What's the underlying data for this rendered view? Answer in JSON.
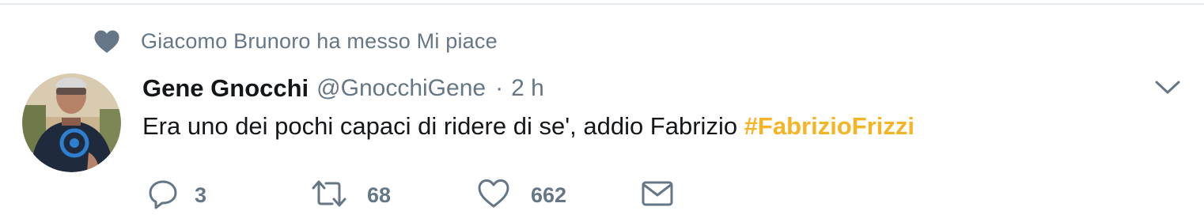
{
  "context": {
    "icon": "heart-icon",
    "text": "Giacomo Brunoro ha messo Mi piace"
  },
  "tweet": {
    "avatar": "avatar",
    "display_name": "Gene Gnocchi",
    "handle": "@GnocchiGene",
    "separator": "·",
    "time": "2 h",
    "text": "Era uno dei pochi capaci di ridere di se', addio Fabrizio ",
    "hashtag": "#FabrizioFrizzi",
    "menu_icon": "chevron-down-icon"
  },
  "actions": {
    "reply": {
      "icon": "reply-icon",
      "count": "3"
    },
    "retweet": {
      "icon": "retweet-icon",
      "count": "68"
    },
    "like": {
      "icon": "heart-outline-icon",
      "count": "662"
    },
    "dm": {
      "icon": "envelope-icon"
    }
  },
  "colors": {
    "text_primary": "#14171a",
    "text_secondary": "#657786",
    "hashtag": "#f4b426",
    "divider": "#e6ecf0"
  }
}
